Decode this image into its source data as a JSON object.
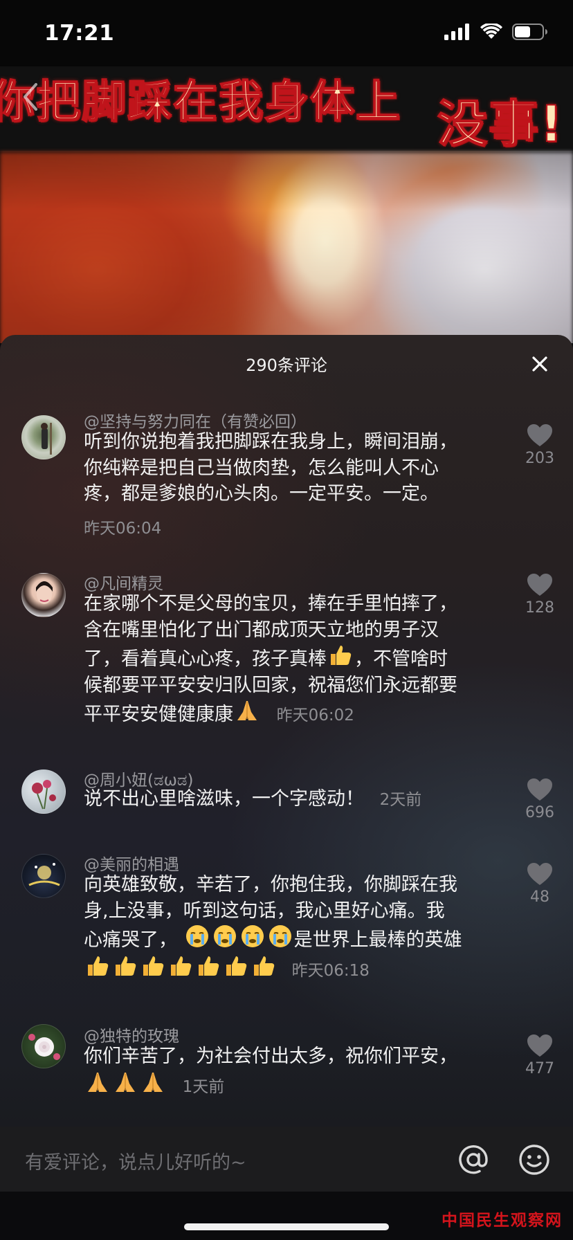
{
  "status_bar": {
    "time": "17:21",
    "icons": [
      "signal-icon",
      "wifi-icon",
      "battery-icon"
    ]
  },
  "video": {
    "caption_line1": "你把脚踩在我身体上",
    "caption_line2": "没事!",
    "caption_color": "#ffe9b8",
    "caption_outline_color": "#c0141b"
  },
  "comments_panel": {
    "title": "290条评论",
    "close_icon": "close-icon",
    "comments": [
      {
        "username": "@坚持与努力同在（有赞必回）",
        "lines": [
          "听到你说抱着我把脚踩在我身上，瞬间泪崩，",
          "你纯粹是把自己当做肉垫，怎么能叫人不心",
          "疼，都是爹娘的心头肉。一定平安。一定。"
        ],
        "time": "昨天06:04",
        "likes": "203"
      },
      {
        "username": "@凡间精灵",
        "lines": [
          "在家哪个不是父母的宝贝，捧在手里怕摔了，",
          "含在嘴里怕化了出门都成顶天立地的男子汉",
          "了，看着真心心疼，孩子真棒",
          "，不管啥时",
          "候都要平平安安归队回家，祝福您们永远都要",
          "平平安安健健康康"
        ],
        "time": "昨天06:02",
        "likes": "128"
      },
      {
        "username": "@周小妞(ಡωಡ)",
        "lines": [
          "说不出心里啥滋味，一个字感动！"
        ],
        "time": "2天前",
        "likes": "696"
      },
      {
        "username": "@美丽的相遇",
        "lines": [
          "向英雄致敬，辛若了，你抱住我，你脚踩在我",
          "身,上没事，听到这句话，我心里好心痛。我",
          "心痛哭了，",
          "是世界上最棒的英雄"
        ],
        "time": "昨天06:18",
        "likes": "48"
      },
      {
        "username": "@独特的玫瑰",
        "lines": [
          "你们辛苦了，为社会付出太多，祝你们平安，"
        ],
        "time": "1天前",
        "likes": "477"
      }
    ]
  },
  "input_bar": {
    "placeholder": "有爱评论，说点儿好听的~",
    "icons": [
      "at-icon",
      "emoji-icon"
    ]
  },
  "watermark": "中国民生观察网",
  "colors": {
    "panel_background": "#262021",
    "text_primary": "#f1f1f1",
    "text_secondary": "#9a9a9e",
    "watermark": "#d4141c"
  }
}
